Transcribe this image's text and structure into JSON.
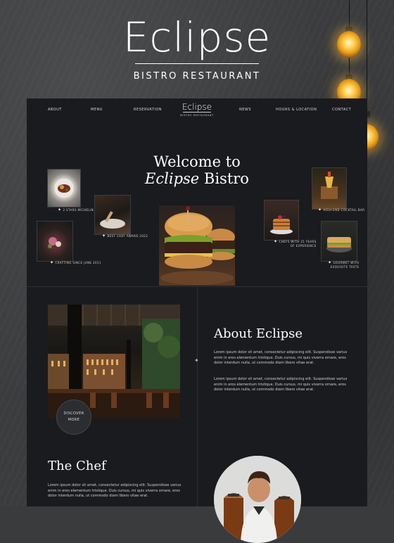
{
  "brand": {
    "name": "Eclipse",
    "tagline": "BISTRO RESTAURANT"
  },
  "nav": {
    "items": [
      "ABOUT",
      "MENU",
      "RESERVATION",
      "NEWS",
      "HOURS & LOCATION",
      "CONTACT"
    ],
    "logo_name": "Eclipse",
    "logo_tagline": "BISTRO RESTAURANT"
  },
  "welcome": {
    "line1": "Welcome to",
    "italic": "Eclipse",
    "rest": " Bistro"
  },
  "features": [
    {
      "caption": "2 STARS MICHELIN"
    },
    {
      "caption": "BEST CHEF AWARD 2022"
    },
    {
      "caption": "CRAFTING SINCE JUNE 2011"
    },
    {
      "caption": "HIGH-END COCKTAIL BAR"
    },
    {
      "caption_line1": "CHEFS WITH 15 YEARS",
      "caption_line2": "OF EXPERIENCE"
    },
    {
      "caption_line1": "GOURMET WITH",
      "caption_line2": "EXQUISITE TASTE"
    }
  ],
  "about": {
    "title": "About Eclipse",
    "para1": "Lorem ipsum dolor sit amet, consectetur adipiscing elit. Suspendisse varius enim in eros elementum tristique. Duis cursus, mi quis viverra ornare, eros dolor interdum nulla, ut commodo diam libero vitae erat.",
    "para2": "Lorem ipsum dolor sit amet, consectetur adipiscing elit. Suspendisse varius enim in eros elementum tristique. Duis cursus, mi quis viverra ornare, eros dolor interdum nulla, ut commodo diam libero vitae erat."
  },
  "discover": {
    "line1": "DISCOVER",
    "line2": "MORE"
  },
  "chef": {
    "title": "The Chef",
    "para1": "Lorem ipsum dolor sit amet, consectetur adipiscing elit. Suspendisse varius enim in eros elementum tristique. Duis cursus, mi quis viverra ornare, eros dolor interdum nulla, ut commodo diam libero vitae erat."
  },
  "colors": {
    "page_bg": "#191b1e",
    "wall": "#3b3c3e",
    "bulb": "#ffcf55"
  }
}
